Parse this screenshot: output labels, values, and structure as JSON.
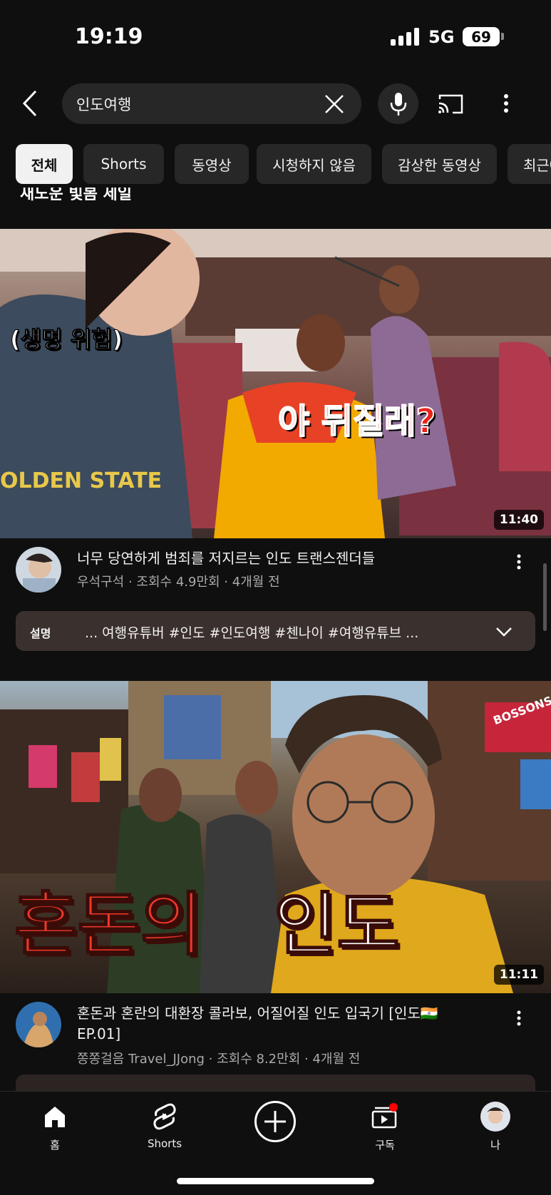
{
  "status_bar": {
    "time": "19:19",
    "network": "5G",
    "battery": "69"
  },
  "search": {
    "query": "인도여행"
  },
  "chips": [
    "전체",
    "Shorts",
    "동영상",
    "시청하지 않음",
    "감상한 동영상",
    "최근에"
  ],
  "peek_title": "새노운 빛봄 세일",
  "videos": [
    {
      "thumb_caption_left": "(생명 위험)",
      "thumb_caption_right": "야 뒤질래?",
      "shirt_text": "OLDEN STATE",
      "duration": "11:40",
      "title": "너무 당연하게 범죄를 저지르는 인도 트랜스젠더들",
      "channel": "우석구석",
      "stats": "조회수 4.9만회",
      "age": "4개월 전"
    },
    {
      "thumb_caption_a": "혼돈의",
      "thumb_caption_b": "인도",
      "shop_sign": "BOSSONS",
      "duration": "11:11",
      "title_line1": "혼돈과 혼란의 대환장 콜라보, 어질어질 인도 입국기 [인도🇮🇳",
      "title_line2": "EP.01]",
      "channel": "쫑쫑걸음 Travel_JJong",
      "stats": "조회수 8.2만회",
      "age": "4개월 전"
    }
  ],
  "description": {
    "label": "설명",
    "text": "... 여행유튜버 #인도 #인도여행 #첸나이 #여행유튜브 ..."
  },
  "nav": {
    "home": "홈",
    "shorts": "Shorts",
    "subs": "구독",
    "me": "나"
  },
  "colors": {
    "accent_red": "#ff0000",
    "background": "#0f0f0f",
    "chip": "#272727"
  }
}
